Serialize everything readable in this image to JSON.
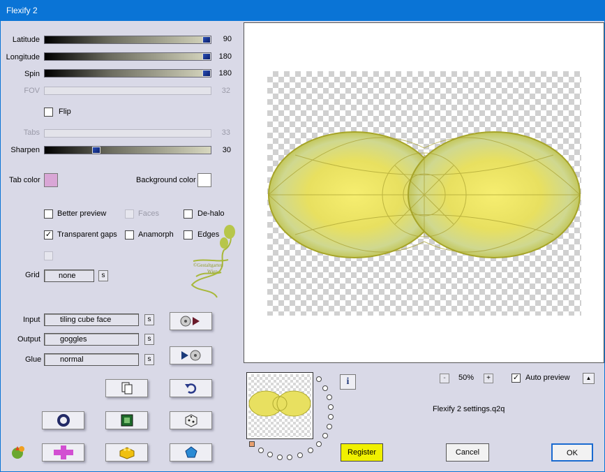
{
  "window": {
    "title": "Flexify 2"
  },
  "sliders": {
    "latitude": {
      "label": "Latitude",
      "value": "90",
      "fraction": 1.0
    },
    "longitude": {
      "label": "Longitude",
      "value": "180",
      "fraction": 1.0
    },
    "spin": {
      "label": "Spin",
      "value": "180",
      "fraction": 1.0
    },
    "fov": {
      "label": "FOV",
      "value": "32"
    },
    "tabs": {
      "label": "Tabs",
      "value": "33"
    },
    "sharpen": {
      "label": "Sharpen",
      "value": "30",
      "fraction": 0.3
    }
  },
  "flip": {
    "label": "Flip"
  },
  "colors": {
    "tab_label": "Tab color",
    "tab_color": "#d9a6d6",
    "bg_label": "Background color",
    "bg_color": "#ffffff"
  },
  "options": {
    "better_preview": {
      "label": "Better preview",
      "checked": false
    },
    "faces": {
      "label": "Faces",
      "checked": false
    },
    "de_halo": {
      "label": "De-halo",
      "checked": false
    },
    "transparent_gaps": {
      "label": "Transparent gaps",
      "checked": true
    },
    "anamorph": {
      "label": "Anamorph",
      "checked": false
    },
    "edges": {
      "label": "Edges",
      "checked": false
    }
  },
  "grid": {
    "label": "Grid",
    "value": "none",
    "s": "s"
  },
  "input": {
    "label": "Input",
    "value": "tiling cube face",
    "s": "s"
  },
  "output": {
    "label": "Output",
    "value": "goggles",
    "s": "s"
  },
  "glue": {
    "label": "Glue",
    "value": "normal",
    "s": "s"
  },
  "watermark": {
    "line1": "©Gestaltgarten",
    "line2": "Wien"
  },
  "zoom": {
    "minus": "-",
    "value": "50%",
    "plus": "+"
  },
  "auto_preview": {
    "label": "Auto preview",
    "checked": true
  },
  "settings_file": "Flexify 2 settings.q2q",
  "buttons": {
    "register": "Register",
    "cancel": "Cancel",
    "ok": "OK",
    "up": "▲"
  }
}
